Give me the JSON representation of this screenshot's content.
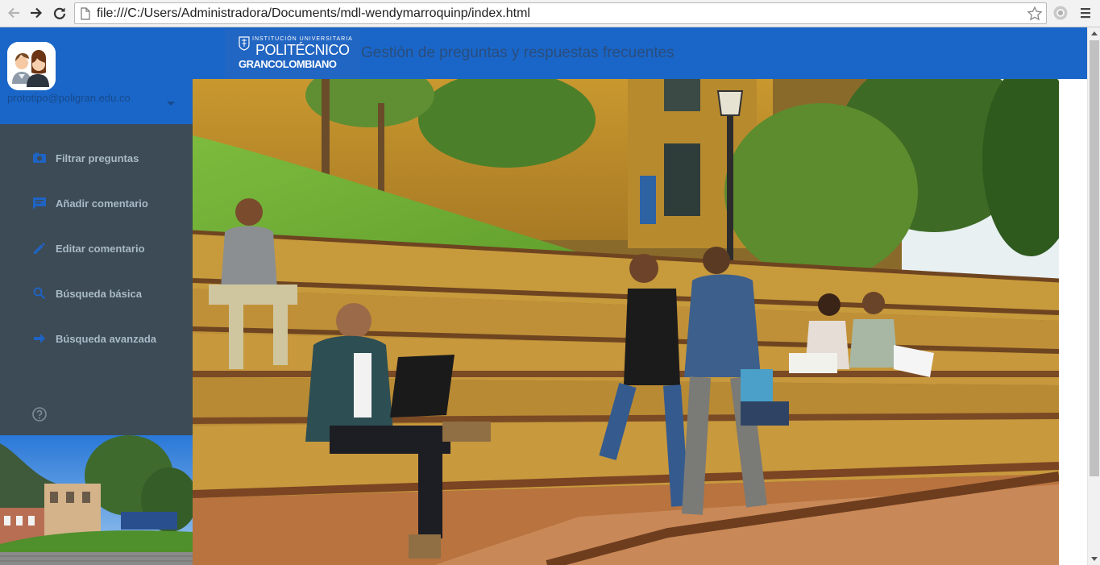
{
  "browser": {
    "url": "file:///C:/Users/Administradora/Documents/mdl-wendymarroquinp/index.html"
  },
  "drawer": {
    "email": "prototipo@poligran.edu.co",
    "items": [
      {
        "label": "Filtrar preguntas",
        "icon": "filter-icon"
      },
      {
        "label": "Añadir comentario",
        "icon": "comment-icon"
      },
      {
        "label": "Editar comentario",
        "icon": "pencil-icon"
      },
      {
        "label": "Búsqueda básica",
        "icon": "search-icon"
      },
      {
        "label": "Búsqueda avanzada",
        "icon": "arrow-forward-icon"
      }
    ]
  },
  "header": {
    "logo": {
      "line1": "INSTITUCIÓN UNIVERSITARIA",
      "line2": "POLITÉCNICO",
      "line3": "GRANCOLOMBIANO"
    },
    "title": "Gestión de preguntas y respuestas frecuentes"
  },
  "colors": {
    "primary": "#1a66c8",
    "drawer": "#3c4b55",
    "drawer_text": "#a9bac8",
    "accent_icon": "#1f63c4"
  }
}
